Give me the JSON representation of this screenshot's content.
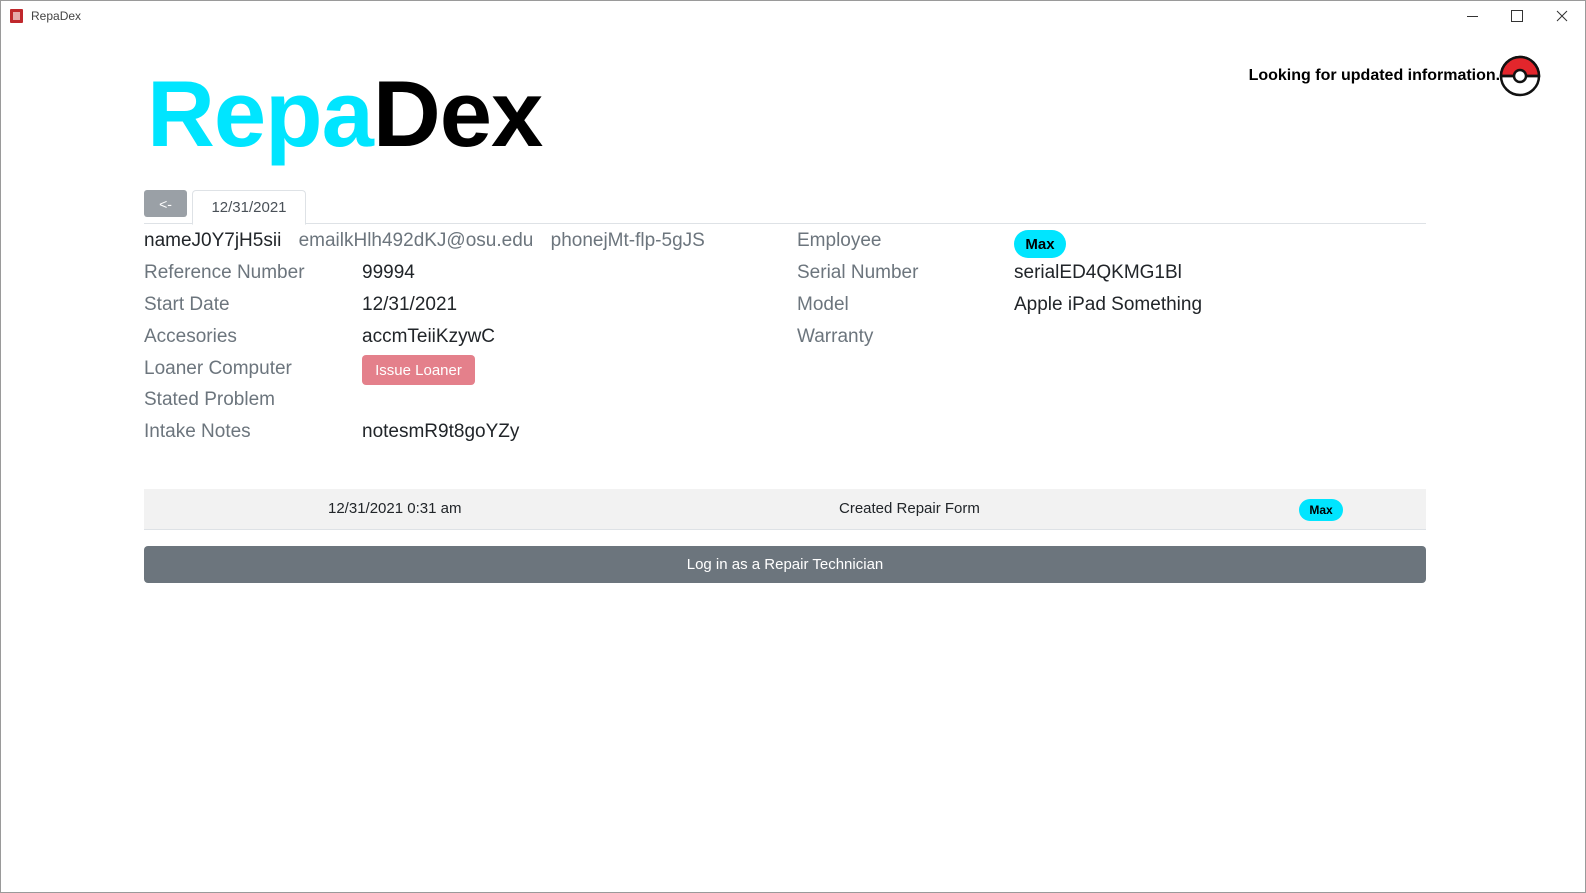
{
  "window": {
    "title": "RepaDex"
  },
  "logo": {
    "part1": "Repa",
    "part2": "Dex",
    "part1_color": "#00e5ff",
    "part2_color": "#000000"
  },
  "status": {
    "text": "Looking for updated information...",
    "icon": "pokeball-icon"
  },
  "tabs": {
    "back_label": "<-",
    "active_tab": "12/31/2021"
  },
  "customer": {
    "name": "nameJ0Y7jH5sii",
    "email": "emailkHlh492dKJ@osu.edu",
    "phone": "phonejMt-flp-5gJS"
  },
  "left_fields": {
    "reference_label": "Reference Number",
    "reference_value": "99994",
    "start_label": "Start Date",
    "start_value": "12/31/2021",
    "accessories_label": "Accesories",
    "accessories_value": "accmTeiiKzywC",
    "loaner_label": "Loaner Computer",
    "loaner_button": "Issue Loaner",
    "problem_label": "Stated Problem",
    "problem_value": "",
    "notes_label": "Intake Notes",
    "notes_value": "notesmR9t8goYZy"
  },
  "right_fields": {
    "employee_label": "Employee",
    "employee_value": "Max",
    "serial_label": "Serial Number",
    "serial_value": "serialED4QKMG1Bl",
    "model_label": "Model",
    "model_value": "Apple iPad Something",
    "warranty_label": "Warranty",
    "warranty_value": ""
  },
  "history": [
    {
      "date": "12/31/2021 0:31 am",
      "action": "Created Repair Form",
      "employee": "Max"
    }
  ],
  "login_button": "Log in as a Repair Technician",
  "colors": {
    "accent": "#00e5ff",
    "danger": "#e4808b",
    "secondary": "#6c757d"
  }
}
